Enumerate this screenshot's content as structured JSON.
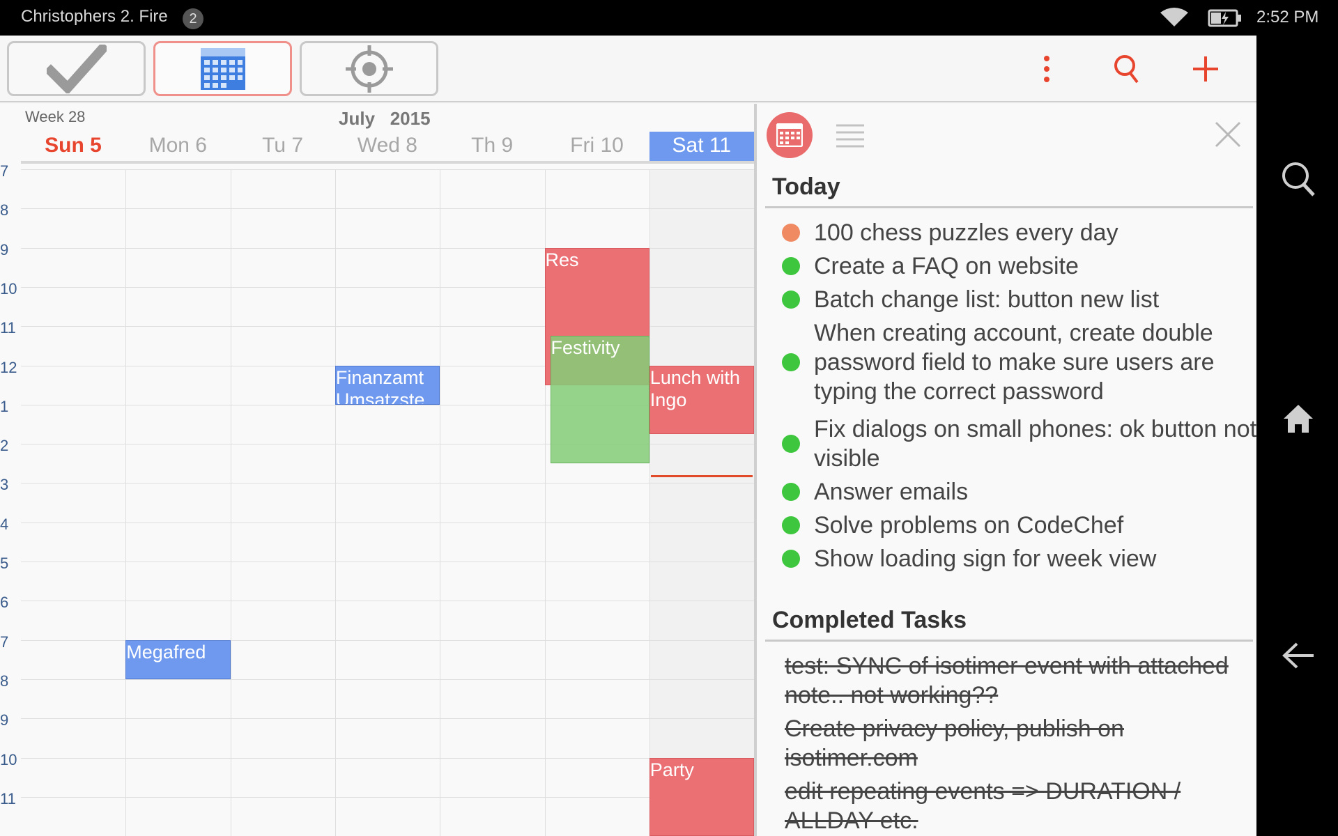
{
  "status_bar": {
    "device_title": "Christophers 2. Fire",
    "notification_count": "2",
    "time": "2:52 PM"
  },
  "toolbar": {
    "modes": [
      {
        "name": "tasks-mode",
        "icon": "checkmark-icon",
        "active": false
      },
      {
        "name": "calendar-mode",
        "icon": "calendar-grid-icon",
        "active": true
      },
      {
        "name": "focus-mode",
        "icon": "crosshair-icon",
        "active": false
      }
    ],
    "actions": [
      "overflow-menu-icon",
      "search-icon",
      "plus-icon"
    ],
    "accent": "#e8452f"
  },
  "calendar": {
    "week_label": "Week 28",
    "month": "July",
    "year": "2015",
    "days": [
      "Sun 5",
      "Mon 6",
      "Tu 7",
      "Wed 8",
      "Th 9",
      "Fri 10",
      "Sat 11"
    ],
    "today_index": 0,
    "selected_index": 6,
    "hours": [
      "7",
      "8",
      "9",
      "10",
      "11",
      "12",
      "1",
      "2",
      "3",
      "4",
      "5",
      "6",
      "7",
      "8",
      "9",
      "10",
      "11"
    ],
    "events": [
      {
        "title": "Res",
        "day": 5,
        "start": "9:00",
        "end": "12:30",
        "color": "#ea7074"
      },
      {
        "title": "Festivity",
        "day": 5,
        "start": "11:15",
        "end": "2:30",
        "color": "#84cd78"
      },
      {
        "title": "Finanzamt Umsatzste",
        "day": 3,
        "start": "12:00",
        "end": "1:00",
        "color": "#6f99ee"
      },
      {
        "title": "Lunch with Ingo",
        "day": 6,
        "start": "12:00",
        "end": "1:45",
        "color": "#ea7074"
      },
      {
        "title": "Megafred",
        "day": 1,
        "start": "7:00",
        "end": "8:00",
        "color": "#6f99ee"
      },
      {
        "title": "Party",
        "day": 6,
        "start": "10:00",
        "end": "12:00",
        "color": "#ea7074"
      }
    ],
    "now_line_color": "#e24b2a"
  },
  "tasks_panel": {
    "today_title": "Today",
    "today_tasks": [
      {
        "text": "100 chess puzzles every day",
        "color": "#f08a62"
      },
      {
        "text": "Create a FAQ on website",
        "color": "#3ec73e"
      },
      {
        "text": "Batch change list: button new list",
        "color": "#3ec73e"
      },
      {
        "text": "When creating account, create double password field to make sure users are typing the correct password",
        "color": "#3ec73e"
      },
      {
        "text": "Fix dialogs on small phones: ok button not visible",
        "color": "#3ec73e"
      },
      {
        "text": "Answer emails",
        "color": "#3ec73e"
      },
      {
        "text": "Solve problems on CodeChef",
        "color": "#3ec73e"
      },
      {
        "text": "Show loading sign for week view",
        "color": "#3ec73e"
      }
    ],
    "completed_title": "Completed Tasks",
    "completed_tasks": [
      "test: SYNC of isotimer event with attached note.. not working??",
      "Create privacy policy, publish on isotimer.com",
      "edit repeating events => DURATION / ALLDAY etc."
    ]
  },
  "nav_bar": [
    "search-icon",
    "home-icon",
    "back-arrow-icon"
  ]
}
